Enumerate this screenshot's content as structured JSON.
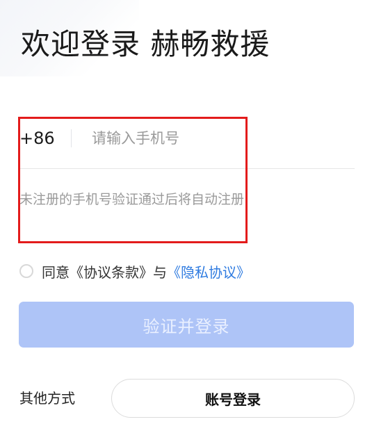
{
  "header": {
    "title": "欢迎登录 赫畅救援"
  },
  "phone": {
    "country_code": "+86",
    "placeholder": "请输入手机号",
    "value": ""
  },
  "hint": {
    "text": "未注册的手机号验证通过后将自动注册"
  },
  "agreement": {
    "checked": false,
    "prefix_text": "同意《协议条款》与",
    "privacy_link": "《隐私协议》"
  },
  "login": {
    "button_label": "验证并登录",
    "enabled": false
  },
  "other": {
    "label": "其他方式",
    "account_login_label": "账号登录"
  },
  "colors": {
    "highlight": "#e31b1b",
    "link": "#2f7be0",
    "button_disabled": "#aec4f7"
  }
}
